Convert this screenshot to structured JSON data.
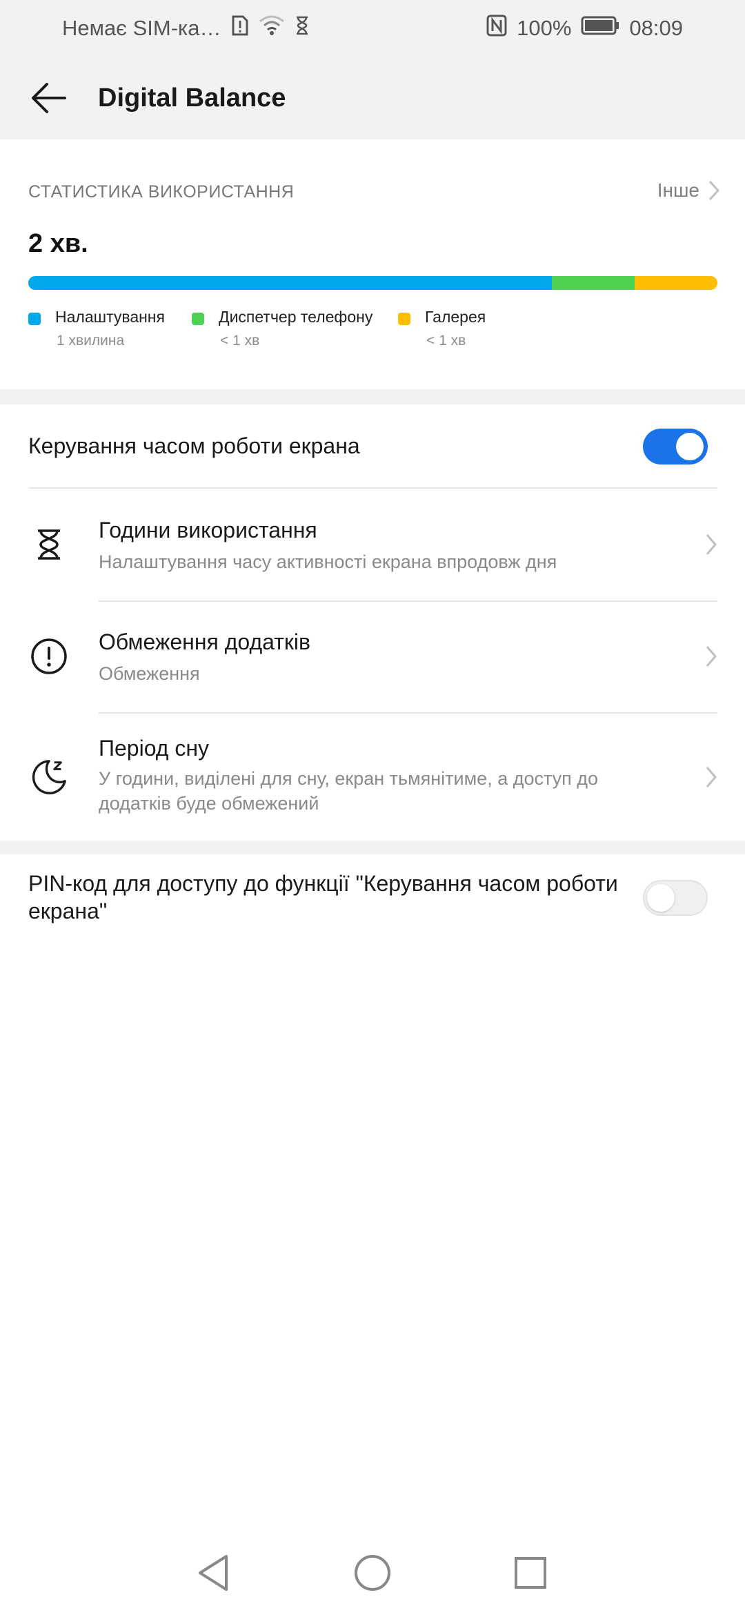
{
  "status_bar": {
    "carrier": "Немає SIM-ка…",
    "battery": "100%",
    "time": "08:09"
  },
  "app_bar": {
    "title": "Digital Balance",
    "back_icon": "arrow-left-icon"
  },
  "usage": {
    "heading": "СТАТИСТИКА ВИКОРИСТАННЯ",
    "more_label": "Інше",
    "total": "2 хв.",
    "segments": [
      {
        "name": "Налаштування",
        "time": "1 хвилина",
        "share": 0.76,
        "color": "#00a8ec"
      },
      {
        "name": "Диспетчер телефону",
        "time": "< 1 хв",
        "share": 0.12,
        "color": "#4cd150"
      },
      {
        "name": "Галерея",
        "time": "< 1 хв",
        "share": 0.12,
        "color": "#ffbf00"
      }
    ]
  },
  "screen_time": {
    "label": "Керування часом роботи екрана",
    "enabled": true
  },
  "items": [
    {
      "title": "Години використання",
      "subtitle": "Налаштування часу активності екрана впродовж дня",
      "icon": "hourglass-icon"
    },
    {
      "title": "Обмеження додатків",
      "subtitle": "Обмеження",
      "icon": "exclamation-circle-icon"
    },
    {
      "title": "Період сну",
      "subtitle": "У години, виділені для сну, екран тьмянітиме, а доступ до додатків буде обмежений",
      "icon": "moon-sleep-icon"
    }
  ],
  "pin": {
    "label": "PIN-код для доступу до функції \"Керування часом роботи екрана\"",
    "enabled": false
  },
  "colors": {
    "accent": "#1a73e8",
    "band": "#f2f2f2"
  }
}
